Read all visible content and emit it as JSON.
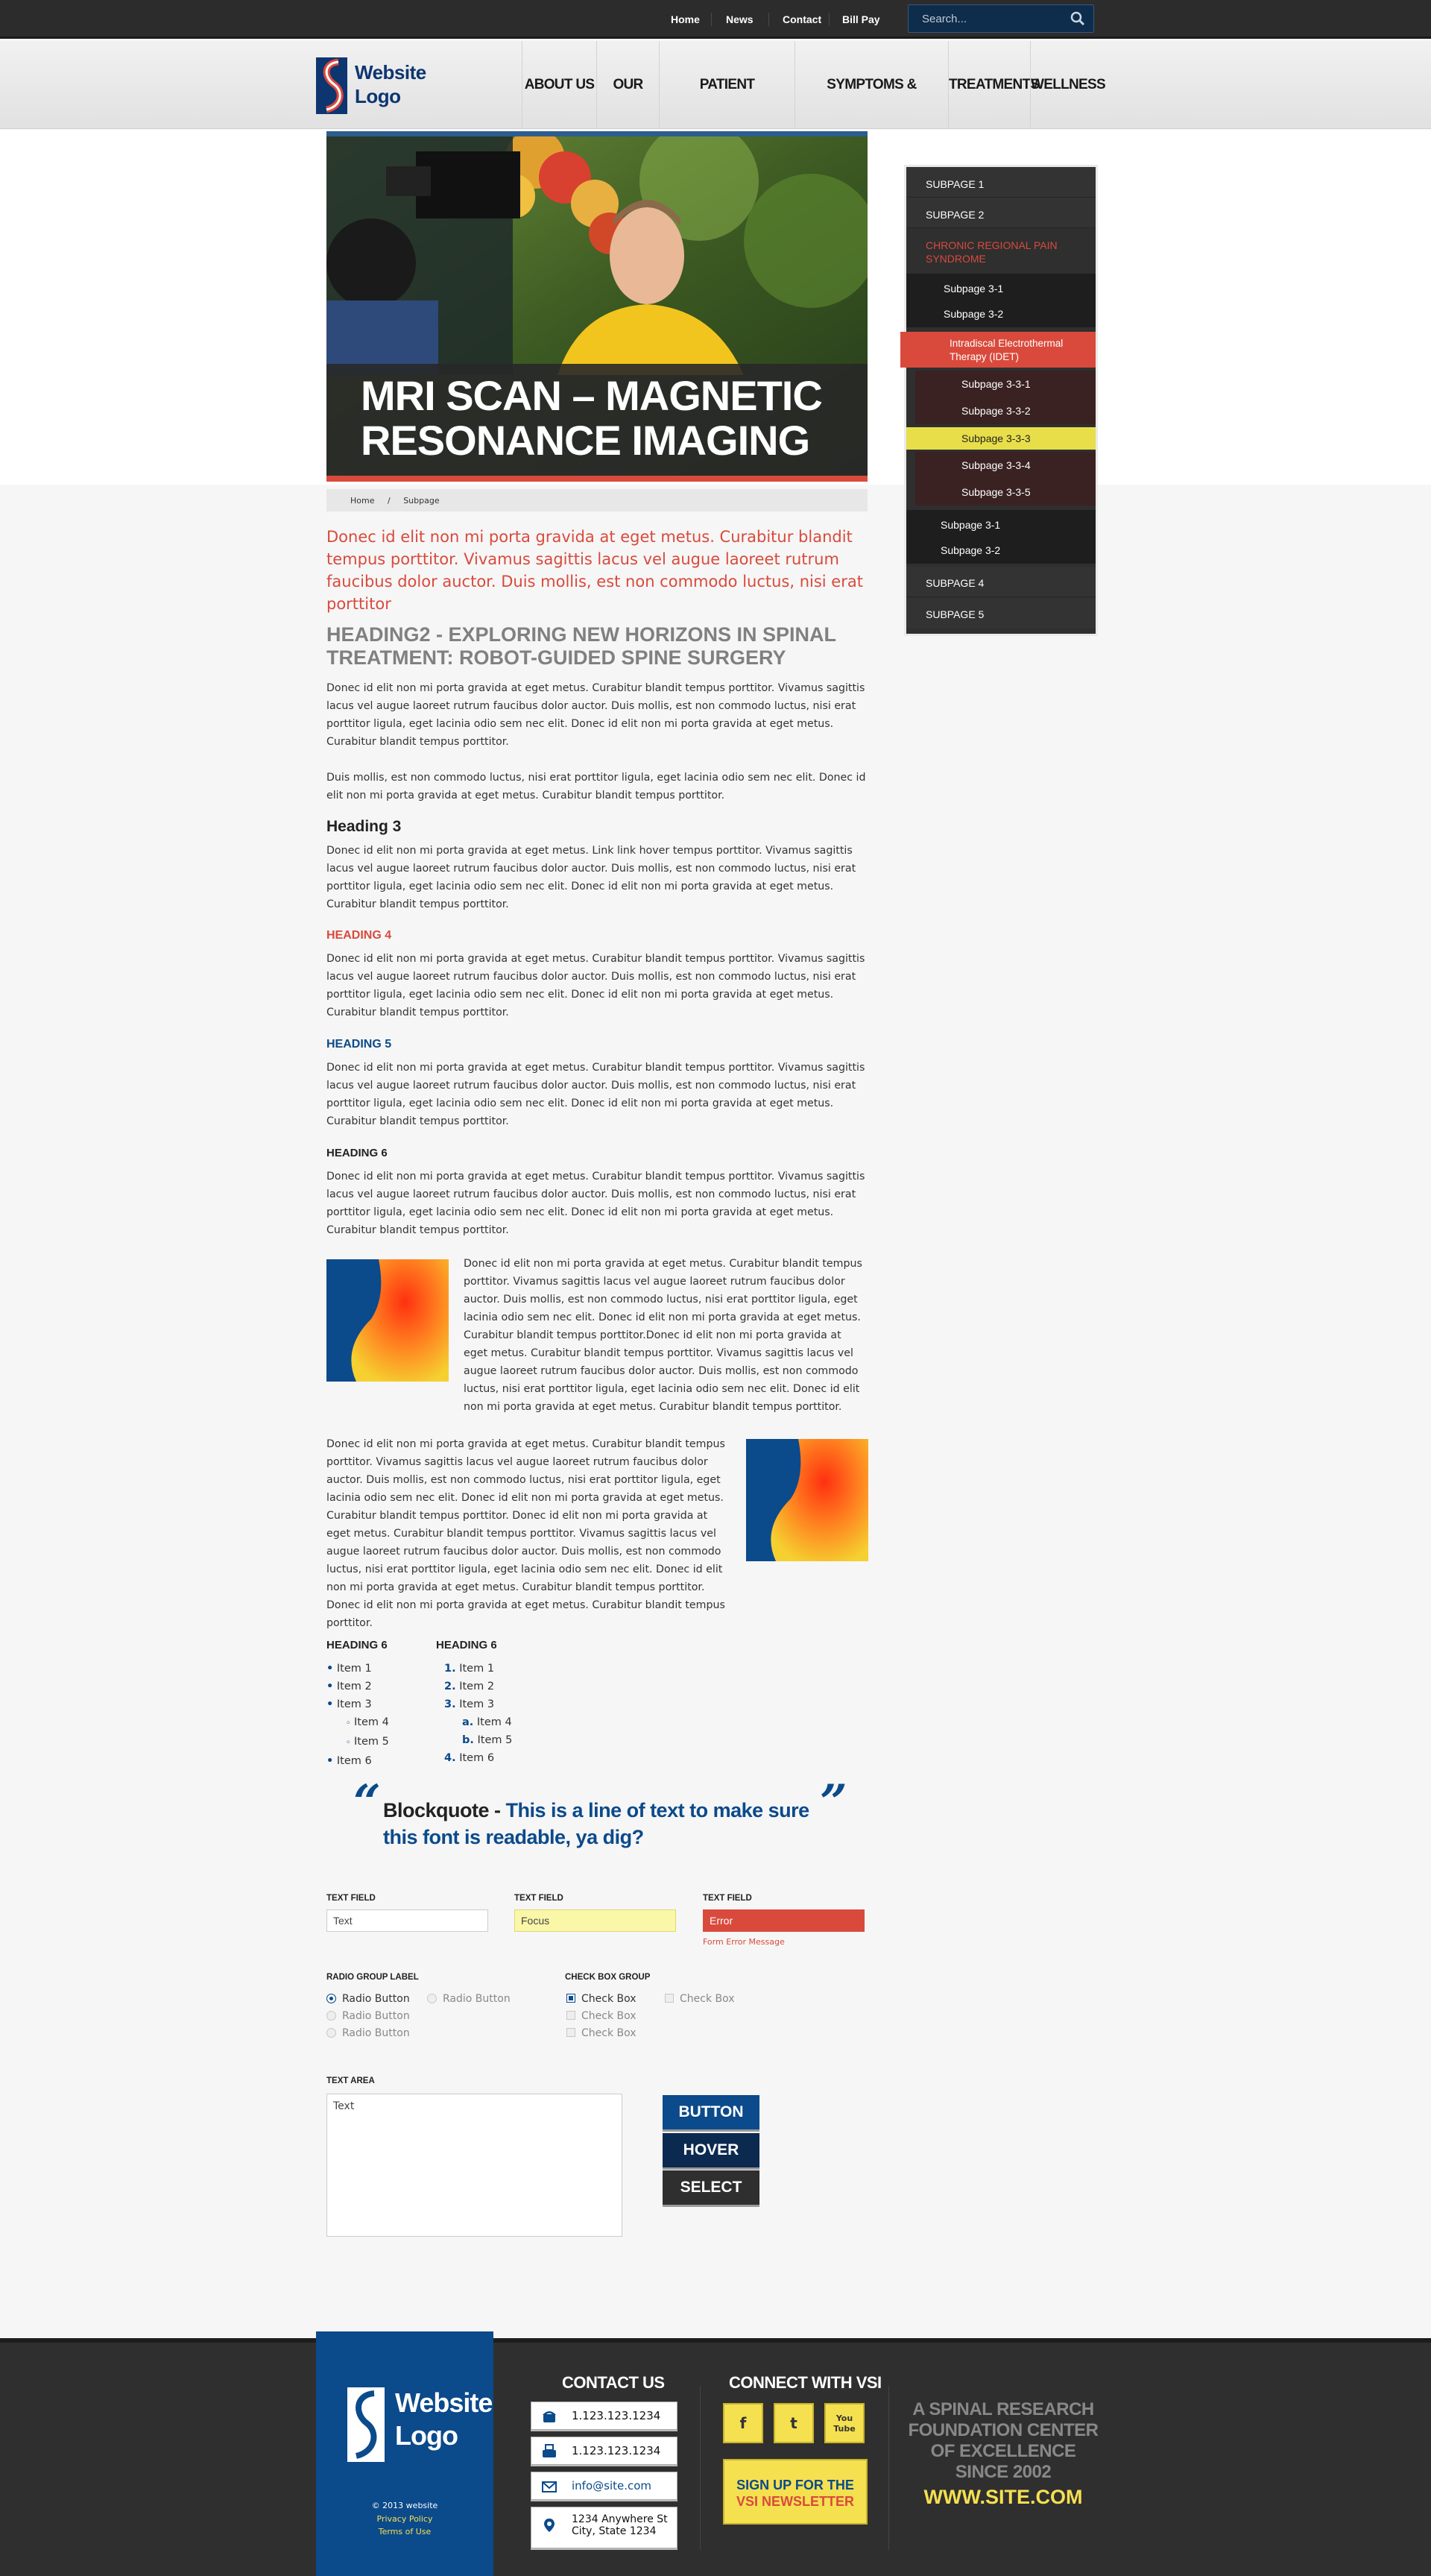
{
  "topbar": {
    "links": [
      "Home",
      "News",
      "Contact",
      "Bill Pay"
    ],
    "search_placeholder": "Search..."
  },
  "header": {
    "logo_line1": "Website",
    "logo_line2": "Logo",
    "nav": [
      "ABOUT US",
      "OUR TEAM",
      "PATIENT RESOURCES",
      "SYMPTOMS & CONDITIONS",
      "TREATMENTS",
      "WELLNESS"
    ]
  },
  "hero": {
    "title_line1": "MRI SCAN – MAGNETIC",
    "title_line2": "RESONANCE IMAGING"
  },
  "breadcrumb": {
    "home": "Home",
    "sep": "/",
    "current": "Subpage"
  },
  "sidebar": {
    "items": [
      "SUBPAGE 1",
      "SUBPAGE 2",
      "CHRONIC REGIONAL PAIN SYNDROME",
      "Subpage 3-1",
      "Subpage 3-2",
      "Intradiscal Electrothermal Therapy (IDET)",
      "Subpage 3-3-1",
      "Subpage 3-3-2",
      "Subpage 3-3-3",
      "Subpage 3-3-4",
      "Subpage 3-3-5",
      "Subpage 3-1",
      "Subpage 3-2",
      "SUBPAGE 4",
      "SUBPAGE 5"
    ],
    "colors": {
      "active_section": "#d94a3c",
      "active_item_bg": "#d94a3c",
      "hover_bg": "#e8de4a"
    }
  },
  "content": {
    "lead": "Donec id elit non mi porta gravida at eget metus. Curabitur blandit tempus porttitor. Vivamus sagittis lacus vel augue laoreet rutrum faucibus dolor auctor. Duis mollis, est non commodo luctus, nisi erat porttitor",
    "h2": "HEADING2 - EXPLORING NEW HORIZONS IN SPINAL TREATMENT: ROBOT-GUIDED SPINE SURGERY",
    "p1": "Donec id elit non mi porta gravida at eget metus. Curabitur blandit tempus porttitor. Vivamus sagittis lacus vel augue laoreet rutrum faucibus dolor auctor. Duis mollis, est non commodo luctus, nisi erat porttitor ligula, eget lacinia odio sem nec elit. Donec id elit non mi porta gravida at eget metus. Curabitur blandit tempus porttitor.",
    "p2": "Duis mollis, est non commodo luctus, nisi erat porttitor ligula, eget lacinia odio sem nec elit. Donec id elit non mi porta gravida at eget metus. Curabitur blandit tempus porttitor.",
    "h3": "Heading 3",
    "p3": "Donec id elit non mi porta gravida at eget metus. Link link hover tempus porttitor. Vivamus sagittis lacus vel augue laoreet rutrum faucibus dolor auctor. Duis mollis, est non commodo luctus, nisi erat porttitor ligula, eget lacinia odio sem nec elit. Donec id elit non mi porta gravida at eget metus. Curabitur blandit tempus porttitor.",
    "h4": "HEADING 4",
    "p4": "Donec id elit non mi porta gravida at eget metus. Curabitur blandit tempus porttitor. Vivamus sagittis lacus vel augue laoreet rutrum faucibus dolor auctor. Duis mollis, est non commodo luctus, nisi erat porttitor ligula, eget lacinia odio sem nec elit. Donec id elit non mi porta gravida at eget metus. Curabitur blandit tempus porttitor.",
    "h5": "HEADING 5",
    "p5": "Donec id elit non mi porta gravida at eget metus. Curabitur blandit tempus porttitor. Vivamus sagittis lacus vel augue laoreet rutrum faucibus dolor auctor. Duis mollis, est non commodo luctus, nisi erat porttitor ligula, eget lacinia odio sem nec elit. Donec id elit non mi porta gravida at eget metus. Curabitur blandit tempus porttitor.",
    "h6": "HEADING 6",
    "p6": "Donec id elit non mi porta gravida at eget metus. Curabitur blandit tempus porttitor. Vivamus sagittis lacus vel augue laoreet rutrum faucibus dolor auctor. Duis mollis, est non commodo luctus, nisi erat porttitor ligula, eget lacinia odio sem nec elit. Donec id elit non mi porta gravida at eget metus. Curabitur blandit tempus porttitor.",
    "p7": "Donec id elit non mi porta gravida at eget metus. Curabitur blandit tempus porttitor. Vivamus sagittis lacus vel augue laoreet rutrum faucibus dolor auctor. Duis mollis, est non commodo luctus, nisi erat porttitor ligula, eget lacinia odio sem nec elit. Donec id elit non mi porta gravida at eget metus. Curabitur blandit tempus porttitor.Donec id elit non mi porta gravida at eget metus. Curabitur blandit tempus porttitor. Vivamus sagittis lacus vel augue laoreet rutrum faucibus dolor auctor. Duis mollis, est non commodo luctus, nisi erat porttitor ligula, eget lacinia odio sem nec elit. Donec id elit non mi porta gravida at eget metus. Curabitur blandit tempus porttitor.",
    "p8": "Donec id elit non mi porta gravida at eget metus. Curabitur blandit tempus porttitor. Vivamus sagittis lacus vel augue laoreet rutrum faucibus dolor auctor. Duis mollis, est non commodo luctus, nisi erat porttitor ligula, eget lacinia odio sem nec elit. Donec id elit non mi porta gravida at eget metus. Curabitur blandit tempus porttitor. Donec id elit non mi porta gravida at eget metus. Curabitur blandit tempus porttitor. Vivamus sagittis lacus vel augue laoreet rutrum faucibus dolor auctor. Duis mollis, est non commodo luctus, nisi erat porttitor ligula, eget lacinia odio sem nec elit. Donec id elit non mi porta gravida at eget metus. Curabitur blandit tempus porttitor. Donec id elit non mi porta gravida at eget metus. Curabitur blandit tempus porttitor."
  },
  "lists": {
    "ul_heading": "HEADING 6",
    "ol_heading": "HEADING 6",
    "items": [
      "Item 1",
      "Item 2",
      "Item 3",
      "Item 4",
      "Item 5",
      "Item 6"
    ],
    "ol_markers": [
      "1.",
      "2.",
      "3.",
      "a.",
      "b.",
      "4."
    ]
  },
  "quote": {
    "open": "“",
    "close": "”",
    "label": "Blockquote -",
    "text": "This is a line of text to make sure this font is readable, ya dig?"
  },
  "form": {
    "text_field_label": "TEXT FIELD",
    "field1_value": "Text",
    "field2_value": "Focus",
    "field3_value": "Error",
    "error_message": "Form Error Message",
    "radio_group_label": "RADIO GROUP LABEL",
    "radio_label": "Radio Button",
    "checkbox_group_label": "CHECK BOX GROUP",
    "checkbox_label": "Check Box",
    "textarea_label": "TEXT AREA",
    "textarea_value": "Text",
    "btn_button": "BUTTON",
    "btn_hover": "HOVER",
    "btn_select": "SELECT"
  },
  "footer": {
    "logo_line1": "Website",
    "logo_line2": "Logo",
    "copyright": "© 2013 website",
    "privacy": "Privacy Policy",
    "terms": "Terms of Use",
    "contact_heading": "CONTACT US",
    "phone": "1.123.123.1234",
    "fax": "1.123.123.1234",
    "email": "info@site.com",
    "address_line1": "1234 Anywhere St",
    "address_line2": "City, State 1234",
    "connect_heading": "CONNECT WITH VSI",
    "social": [
      "f",
      "t",
      "You Tube"
    ],
    "newsletter_line1": "SIGN UP FOR THE",
    "newsletter_line2": "VSI NEWSLETTER",
    "tagline": "A SPINAL RESEARCH FOUNDATION CENTER OF EXCELLENCE SINCE 2002",
    "site": "WWW.SITE.COM"
  }
}
